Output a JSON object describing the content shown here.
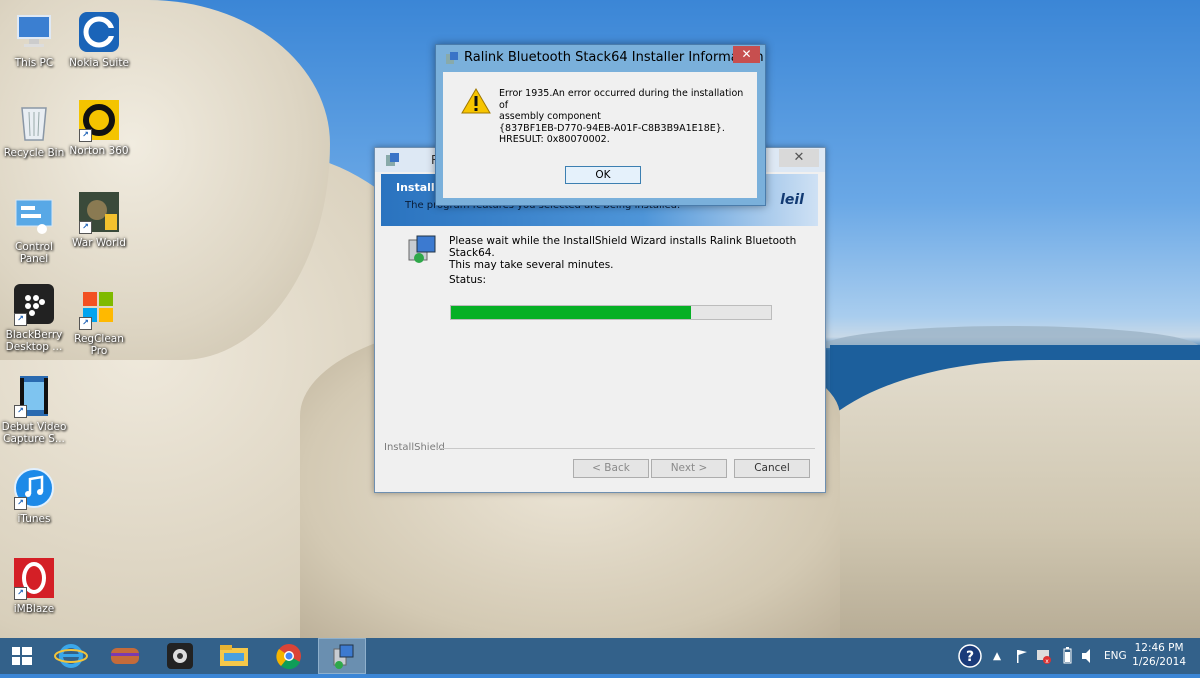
{
  "desktop_icons": [
    {
      "label": "This PC",
      "icon": "computer-icon"
    },
    {
      "label": "Nokia Suite",
      "icon": "nokia-suite-icon"
    },
    {
      "label": "Recycle Bin",
      "icon": "recycle-bin-icon"
    },
    {
      "label": "Norton 360",
      "icon": "norton-icon"
    },
    {
      "label": "Control Panel",
      "icon": "control-panel-icon"
    },
    {
      "label": "War World",
      "icon": "war-world-icon"
    },
    {
      "label": "BlackBerry Desktop ...",
      "icon": "blackberry-icon"
    },
    {
      "label": "RegClean Pro",
      "icon": "regclean-icon"
    },
    {
      "label": "Debut Video Capture S...",
      "icon": "debut-video-icon"
    },
    {
      "label": "iTunes",
      "icon": "itunes-icon"
    },
    {
      "label": "iMBlaze",
      "icon": "imblaze-icon"
    }
  ],
  "installer": {
    "title_partial": "R",
    "banner_title": "Installin",
    "banner_subtitle": "The program features you selected are being installed.",
    "banner_logo": "leil",
    "message_line1": "Please wait while the InstallShield Wizard installs Ralink Bluetooth Stack64.",
    "message_line2": "This may take several minutes.",
    "status_label": "Status:",
    "progress_fraction": 0.75,
    "brand": "InstallShield",
    "back_label": "< Back",
    "next_label": "Next >",
    "cancel_label": "Cancel"
  },
  "error_dialog": {
    "title": "Ralink Bluetooth Stack64 Installer Information",
    "line1": "Error 1935.An error occurred during the installation of",
    "line2": "assembly component",
    "line3": "{837BF1EB-D770-94EB-A01F-C8B3B9A1E18E}.",
    "line4": "HRESULT: 0x80070002.",
    "ok_label": "OK",
    "close_glyph": "✕"
  },
  "taskbar": {
    "apps": [
      "start-icon",
      "internet-explorer-icon",
      "winrar-icon",
      "camera-app-icon",
      "file-explorer-icon",
      "chrome-icon",
      "installer-task-icon"
    ],
    "language": "ENG",
    "time": "12:46 PM",
    "date": "1/26/2014"
  },
  "colors": {
    "progress": "#06b025",
    "taskbar": "#33618a",
    "dialog_frame": "#7ab0db",
    "close_red": "#c74f4f"
  }
}
